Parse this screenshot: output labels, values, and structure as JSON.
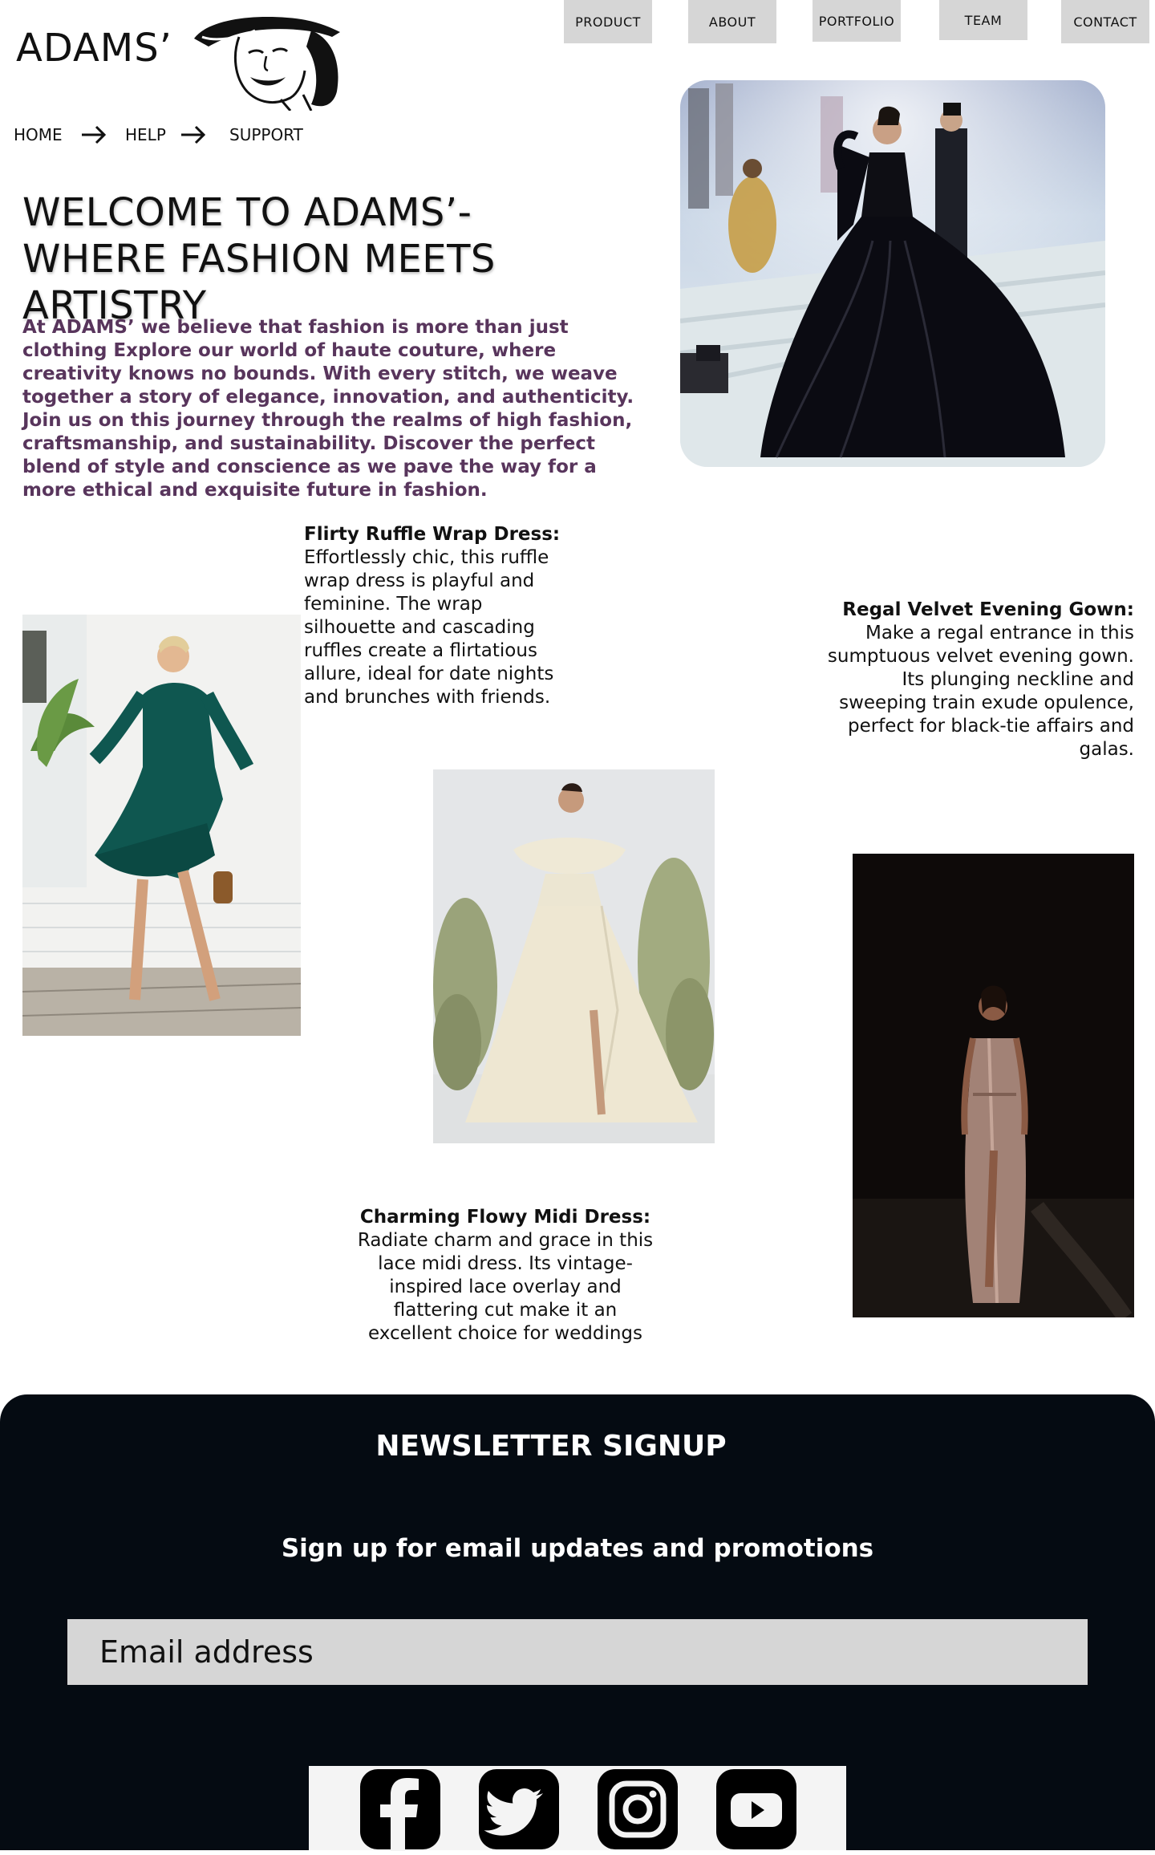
{
  "brand": {
    "name": "ADAMS’"
  },
  "nav": {
    "items": [
      "PRODUCT",
      "ABOUT",
      "PORTFOLIO",
      "TEAM",
      "CONTACT"
    ]
  },
  "breadcrumb": {
    "items": [
      "HOME",
      "HELP",
      "SUPPORT"
    ]
  },
  "hero": {
    "title_line1": "WELCOME TO ADAMS’-",
    "title_line2": "WHERE FASHION MEETS ARTISTRY",
    "intro": "At ADAMS’ we believe that fashion is more than just clothing Explore our world of haute couture, where creativity knows no bounds. With every stitch, we weave together a story of elegance, innovation, and authenticity.",
    "intro2": "Join us on this journey through the realms of high fashion, craftsmanship, and sustainability. Discover the perfect blend of style and conscience as we pave the way for a more ethical and exquisite future in fashion."
  },
  "products": [
    {
      "title": "Flirty Ruffle Wrap Dress:",
      "lines": [
        "Effortlessly chic, this ruffle",
        "wrap dress is playful and",
        "feminine. The wrap",
        "silhouette and cascading",
        "ruffles create a flirtatious",
        "allure, ideal for date nights",
        "and brunches with friends."
      ]
    },
    {
      "title": "Regal Velvet Evening Gown:",
      "lines": [
        "Make a regal entrance in this",
        "sumptuous velvet evening gown.",
        "Its plunging neckline and",
        "sweeping train exude opulence,",
        "perfect for black-tie affairs and",
        "galas."
      ]
    },
    {
      "title": "Charming Flowy Midi Dress:",
      "lines": [
        "Radiate charm and grace in this",
        "lace midi dress. Its vintage-",
        "inspired lace overlay and",
        "flattering cut make it an",
        "excellent choice for weddings"
      ]
    }
  ],
  "newsletter": {
    "title": "NEWSLETTER SIGNUP",
    "subtitle": "Sign up for email updates and promotions",
    "email_placeholder": "Email address"
  },
  "social": [
    "facebook-icon",
    "twitter-icon",
    "instagram-icon",
    "youtube-icon"
  ],
  "colors": {
    "intro_text": "#58355c",
    "nav_bg": "#d6d6d6",
    "footer_bg": "#050b12"
  }
}
